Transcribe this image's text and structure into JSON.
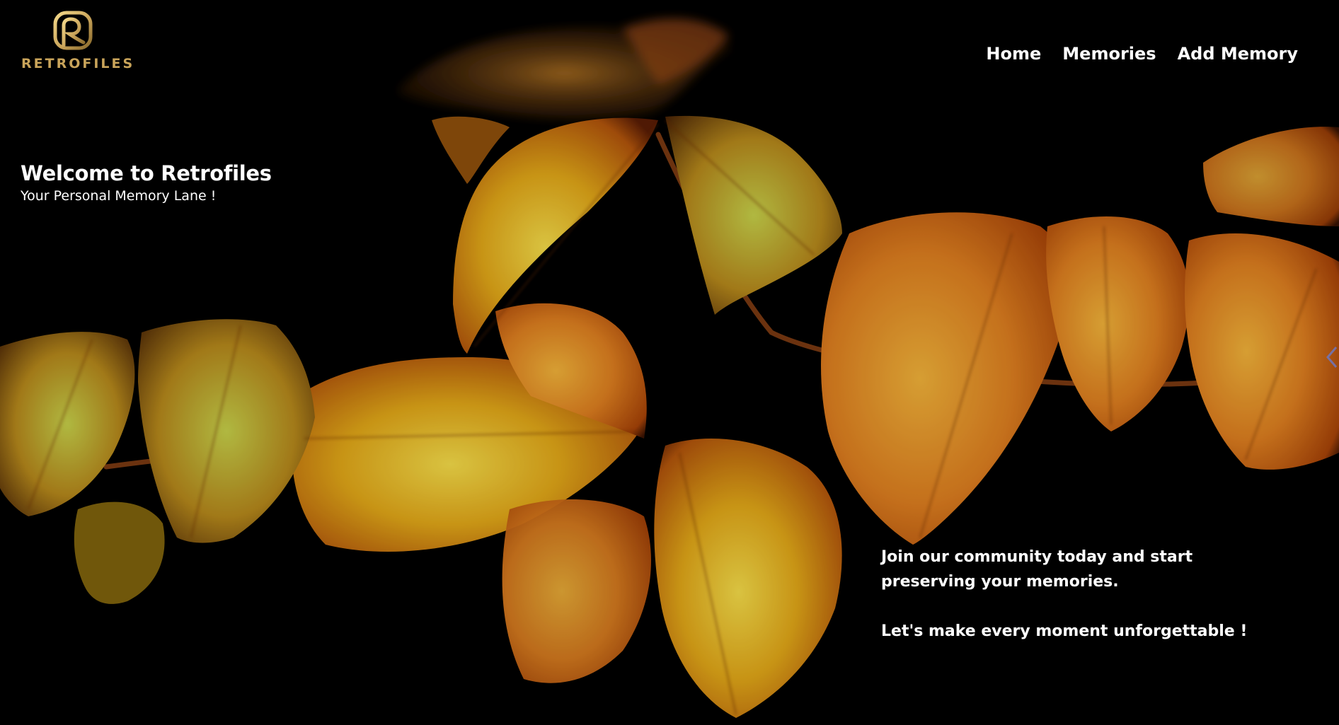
{
  "brand": {
    "logo_text": "RETROFILES",
    "logo_icon": "retrofiles-monogram-icon",
    "accent_color": "#c9a45a"
  },
  "nav": {
    "items": [
      {
        "label": "Home"
      },
      {
        "label": "Memories"
      },
      {
        "label": "Add Memory"
      }
    ]
  },
  "hero": {
    "title": "Welcome to Retrofiles",
    "subtitle": "Your Personal Memory Lane !",
    "background": "autumn-leaves-photo",
    "cta_lines": [
      "Join our community today and start preserving your memories.",
      "Let's make every moment unforgettable !"
    ]
  },
  "colors": {
    "background": "#000000",
    "text": "#ffffff",
    "leaf_gold": "#e9b81f",
    "leaf_orange": "#d86d12"
  }
}
